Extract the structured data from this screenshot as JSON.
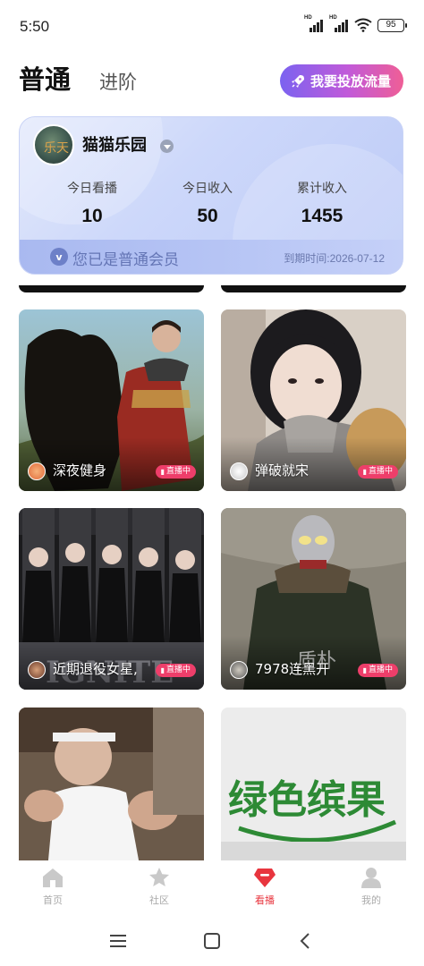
{
  "status_bar": {
    "time": "5:50",
    "signal1_label": "HD",
    "signal2_label": "HD",
    "battery": "95"
  },
  "header": {
    "tab_active": "普通",
    "tab_inactive": "进阶",
    "promo_button": "我要投放流量",
    "promo_icon": "rocket-icon"
  },
  "member_card": {
    "username": "猫猫乐园",
    "avatar_text": "乐天",
    "stats": [
      {
        "label": "今日看播",
        "value": "10"
      },
      {
        "label": "今日收入",
        "value": "50"
      },
      {
        "label": "累计收入",
        "value": "1455"
      }
    ],
    "member_badge": "v",
    "member_status": "您已是普通会员",
    "expiry": "到期时间:2026-07-12"
  },
  "streams": [
    {
      "name": "深夜健身",
      "badge": "直播中",
      "live_icon": "live-icon"
    },
    {
      "name": "弹破就宋",
      "badge": "直播中",
      "live_icon": "live-icon"
    },
    {
      "name": "近期退役女星,",
      "badge": "直播中",
      "live_icon": "live-icon"
    },
    {
      "name": "7978连黑开",
      "badge": "直播中",
      "live_icon": "live-icon",
      "overlay_text": "质朴"
    },
    {
      "name": "",
      "badge": ""
    },
    {
      "name": "",
      "badge": "",
      "overlay_text": "绿色缤果"
    }
  ],
  "bottom_nav": {
    "items": [
      {
        "label": "首页",
        "icon": "home-icon"
      },
      {
        "label": "社区",
        "icon": "star-icon"
      },
      {
        "label": "看播",
        "icon": "live-gem-icon",
        "active": true
      },
      {
        "label": "我的",
        "icon": "profile-icon"
      }
    ]
  },
  "colors": {
    "accent_red": "#e8353e",
    "live_badge": "#ee3e6a",
    "promo_start": "#7b62f0",
    "promo_end": "#ef5e96"
  }
}
